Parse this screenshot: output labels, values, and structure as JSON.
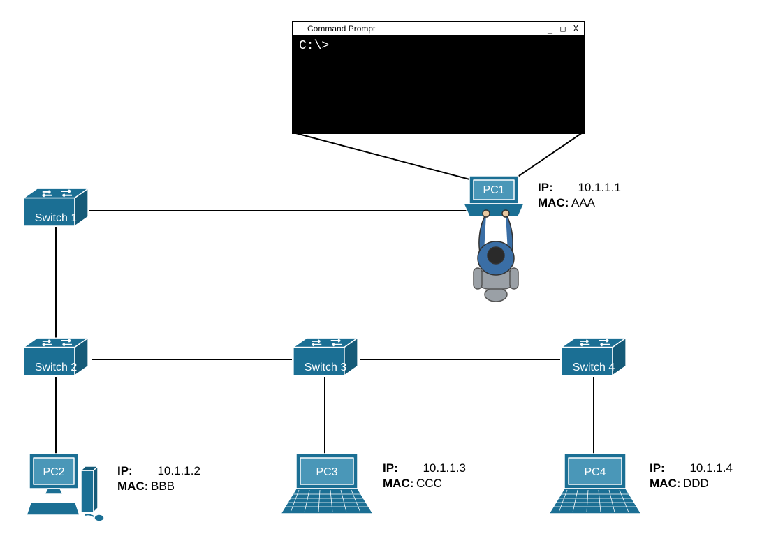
{
  "cmd": {
    "title": "Command Prompt",
    "controls": "_ □ X",
    "prompt": "C:\\>"
  },
  "switches": {
    "s1": "Switch 1",
    "s2": "Switch 2",
    "s3": "Switch 3",
    "s4": "Switch 4"
  },
  "devices": {
    "pc1": {
      "label": "PC1",
      "ip_k": "IP:",
      "ip_v": "10.1.1.1",
      "mac_k": "MAC:",
      "mac_v": "AAA"
    },
    "pc2": {
      "label": "PC2",
      "ip_k": "IP:",
      "ip_v": "10.1.1.2",
      "mac_k": "MAC:",
      "mac_v": "BBB"
    },
    "pc3": {
      "label": "PC3",
      "ip_k": "IP:",
      "ip_v": "10.1.1.3",
      "mac_k": "MAC:",
      "mac_v": "CCC"
    },
    "pc4": {
      "label": "PC4",
      "ip_k": "IP:",
      "ip_v": "10.1.1.4",
      "mac_k": "MAC:",
      "mac_v": "DDD"
    }
  },
  "colors": {
    "device_fill": "#1b6f94",
    "device_stroke": "#ffffff",
    "user_shirt": "#3a6ea5",
    "user_skin": "#e8c8a0",
    "chair": "#9aa0a6",
    "line": "#000000"
  }
}
